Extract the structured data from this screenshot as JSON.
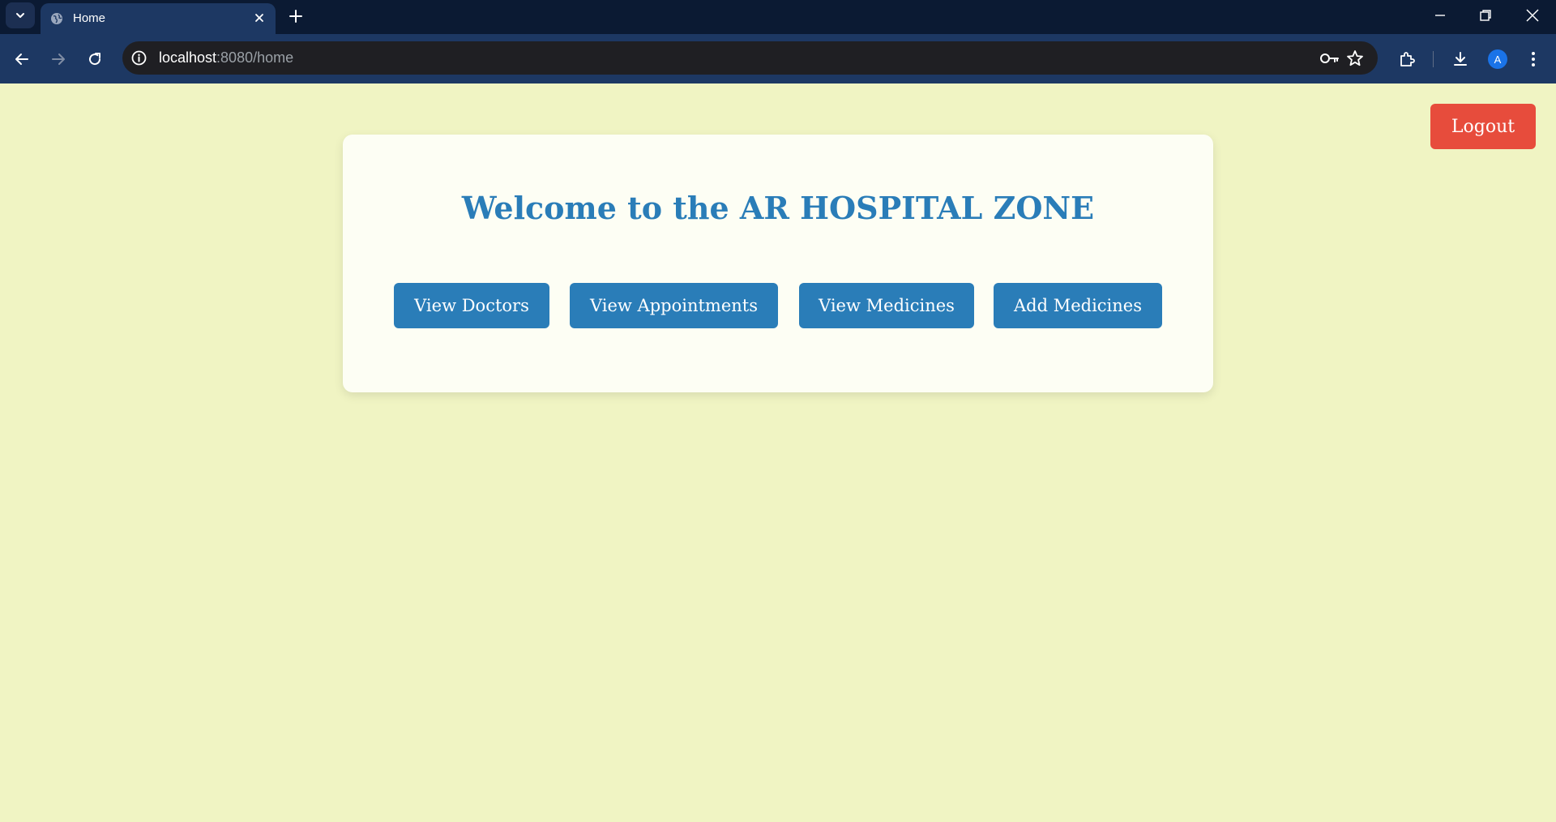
{
  "browser": {
    "tab_title": "Home",
    "url_host": "localhost",
    "url_path": ":8080/home",
    "profile_initial": "A"
  },
  "page": {
    "logout_label": "Logout",
    "welcome_title": "Welcome to the AR HOSPITAL ZONE",
    "actions": [
      {
        "label": "View Doctors"
      },
      {
        "label": "View Appointments"
      },
      {
        "label": "View Medicines"
      },
      {
        "label": "Add Medicines"
      }
    ]
  },
  "colors": {
    "page_background": "#f0f4c3",
    "card_background": "#fdfef4",
    "primary": "#2a7db8",
    "danger": "#e74c3c",
    "browser_frame": "#0b1a33",
    "browser_toolbar": "#1d3863"
  }
}
